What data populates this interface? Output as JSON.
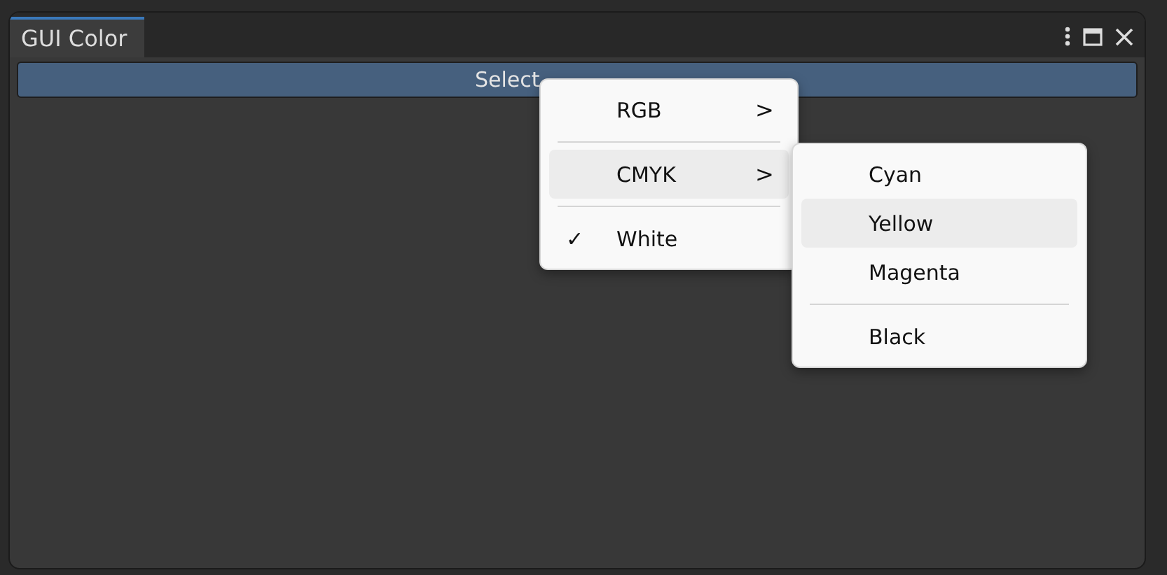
{
  "window": {
    "title": "GUI Color"
  },
  "button": {
    "label": "Select"
  },
  "menu": {
    "check_mark": "✓",
    "items": [
      {
        "kind": "submenu",
        "label": "RGB",
        "arrow": ">",
        "highlighted": false,
        "checked": false
      },
      {
        "kind": "separator"
      },
      {
        "kind": "submenu",
        "label": "CMYK",
        "arrow": ">",
        "highlighted": true,
        "checked": false,
        "children": [
          {
            "kind": "item",
            "label": "Cyan",
            "highlighted": false
          },
          {
            "kind": "item",
            "label": "Yellow",
            "highlighted": true
          },
          {
            "kind": "item",
            "label": "Magenta",
            "highlighted": false
          },
          {
            "kind": "separator"
          },
          {
            "kind": "item",
            "label": "Black",
            "highlighted": false
          }
        ]
      },
      {
        "kind": "separator"
      },
      {
        "kind": "item",
        "label": "White",
        "highlighted": false,
        "checked": true
      }
    ]
  }
}
